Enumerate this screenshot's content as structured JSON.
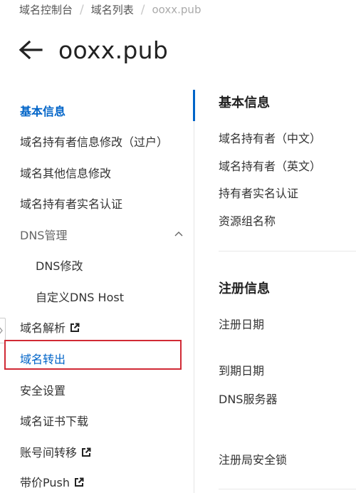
{
  "breadcrumb": {
    "items": [
      "域名控制台",
      "域名列表",
      "ooxx.pub"
    ],
    "separator": "/"
  },
  "header": {
    "back_icon": "arrow-left-icon",
    "title": "ooxx.pub"
  },
  "sidebar": {
    "items": [
      {
        "label": "基本信息",
        "active": true
      },
      {
        "label": "域名持有者信息修改（过户）"
      },
      {
        "label": "域名其他信息修改"
      },
      {
        "label": "域名持有者实名认证"
      },
      {
        "label": "DNS管理",
        "expanded": true,
        "icon": "chevron-up-icon"
      },
      {
        "label": "DNS修改",
        "child": true
      },
      {
        "label": "自定义DNS Host",
        "child": true
      },
      {
        "label": "域名解析",
        "icon": "external-link-icon"
      },
      {
        "label": "域名转出",
        "highlighted": true
      },
      {
        "label": "安全设置"
      },
      {
        "label": "域名证书下载"
      },
      {
        "label": "账号间转移",
        "icon": "external-link-icon"
      },
      {
        "label": "带价Push",
        "icon": "external-link-icon"
      }
    ]
  },
  "main": {
    "sections": [
      {
        "title": "基本信息",
        "fields": [
          "域名持有者（中文）",
          "域名持有者（英文）",
          "持有者实名认证",
          "资源组名称"
        ]
      },
      {
        "title": "注册信息",
        "fields": [
          "注册日期",
          "到期日期",
          "DNS服务器",
          "注册局安全锁"
        ]
      }
    ]
  },
  "colors": {
    "accent": "#0064c8",
    "highlight_border": "#d12a35",
    "text": "#333333",
    "muted": "#aaaaaa"
  }
}
